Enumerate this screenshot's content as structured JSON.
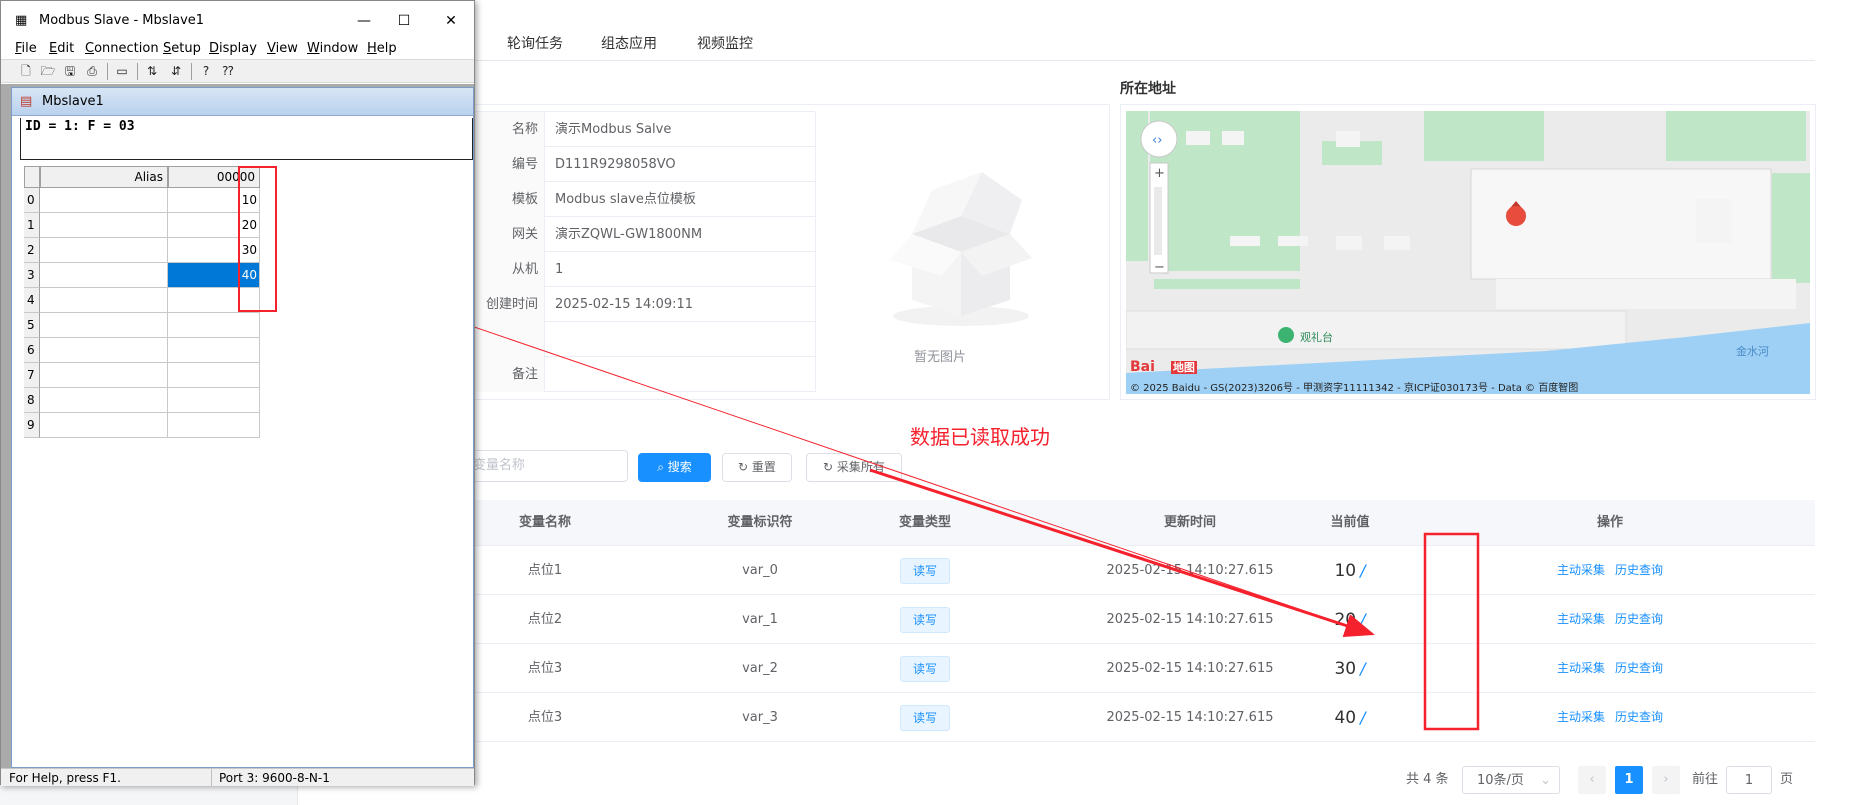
{
  "web": {
    "tabs": [
      "轮询任务",
      "组态应用",
      "视频监控"
    ],
    "map_title": "所在地址",
    "info_rows": [
      {
        "key": "名称",
        "value": "演示Modbus Salve"
      },
      {
        "key": "编号",
        "value": "D111R9298058VO"
      },
      {
        "key": "模板",
        "value": "Modbus slave点位模板"
      },
      {
        "key": "网关",
        "value": "演示ZQWL-GW1800NM"
      },
      {
        "key": "从机",
        "value": "1"
      },
      {
        "key": "创建时间",
        "value": "2025-02-15 14:09:11"
      },
      {
        "key": "",
        "value": ""
      },
      {
        "key": "备注",
        "value": ""
      }
    ],
    "no_image_label": "暂无图片",
    "map": {
      "poi_label": "观礼台",
      "river_label": "金水河",
      "copyright": "© 2025 Baidu - GS(2023)3206号 - 甲测资字11111342 - 京ICP证030173号 - Data © 百度智图",
      "baidu_logo": "Bai",
      "baidu_logo_suffix": "地图"
    },
    "success_message": "数据已读取成功",
    "search_placeholder": "变量名称",
    "buttons": {
      "search": "搜索",
      "reset": "重置",
      "collect_all": "采集所有"
    },
    "table": {
      "headers": [
        "变量名称",
        "变量标识符",
        "变量类型",
        "更新时间",
        "当前值",
        "操作"
      ],
      "rows": [
        {
          "name": "点位1",
          "id": "var_0",
          "type": "读写",
          "time": "2025-02-15 14:10:27.615",
          "value": "10",
          "unit": "/",
          "op1": "主动采集",
          "op2": "历史查询"
        },
        {
          "name": "点位2",
          "id": "var_1",
          "type": "读写",
          "time": "2025-02-15 14:10:27.615",
          "value": "20",
          "unit": "/",
          "op1": "主动采集",
          "op2": "历史查询"
        },
        {
          "name": "点位3",
          "id": "var_2",
          "type": "读写",
          "time": "2025-02-15 14:10:27.615",
          "value": "30",
          "unit": "/",
          "op1": "主动采集",
          "op2": "历史查询"
        },
        {
          "name": "点位3",
          "id": "var_3",
          "type": "读写",
          "time": "2025-02-15 14:10:27.615",
          "value": "40",
          "unit": "/",
          "op1": "主动采集",
          "op2": "历史查询"
        }
      ]
    },
    "pager": {
      "total": "共 4 条",
      "page_size": "10条/页",
      "current_page": "1",
      "goto_label": "前往",
      "goto_value": "1",
      "goto_suffix": "页"
    }
  },
  "modbus": {
    "title": "Modbus Slave - Mbslave1",
    "window_controls": {
      "min": "—",
      "max": "☐",
      "close": "✕"
    },
    "menu": [
      {
        "key": "F",
        "rest": "ile"
      },
      {
        "key": "E",
        "rest": "dit"
      },
      {
        "key": "C",
        "rest": "onnection"
      },
      {
        "key": "S",
        "rest": "etup"
      },
      {
        "key": "D",
        "rest": "isplay"
      },
      {
        "key": "V",
        "rest": "iew"
      },
      {
        "key": "W",
        "rest": "indow"
      },
      {
        "key": "H",
        "rest": "elp"
      }
    ],
    "child_title": "Mbslave1",
    "id_line": "ID = 1: F = 03",
    "grid": {
      "col_alias": "Alias",
      "col_addr": "00000",
      "rows": [
        "0",
        "1",
        "2",
        "3",
        "4",
        "5",
        "6",
        "7",
        "8",
        "9"
      ],
      "values": [
        "10",
        "20",
        "30",
        "40",
        "",
        "",
        "",
        "",
        "",
        ""
      ],
      "selected_row": 3
    },
    "status_left": "For Help, press F1.",
    "status_right": "Port 3: 9600-8-N-1"
  },
  "colors": {
    "accent": "#1890ff",
    "annotation": "#f5222d",
    "grid_select": "#0078d7"
  }
}
